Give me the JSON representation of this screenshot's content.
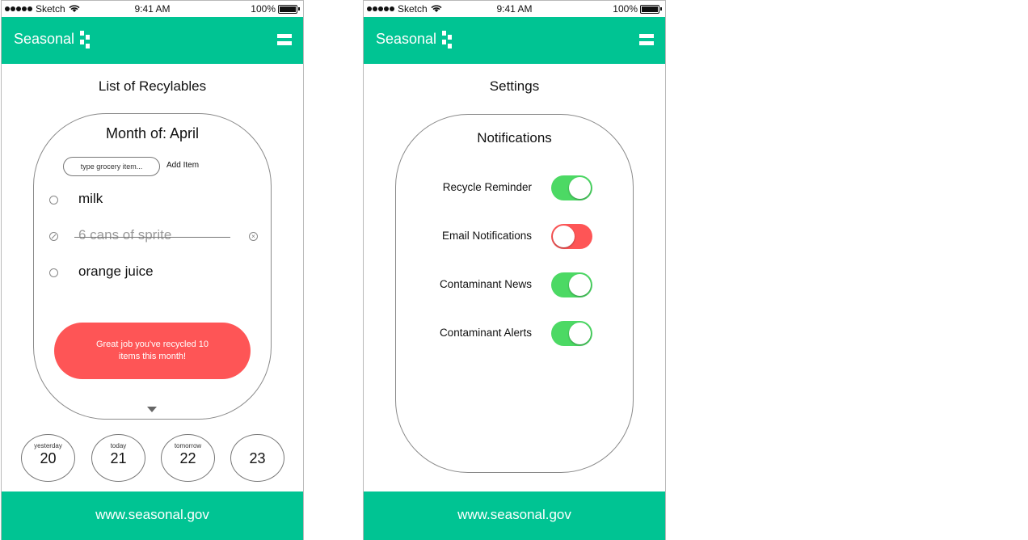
{
  "colors": {
    "brand": "#00c493",
    "accent_red": "#fe5556",
    "toggle_on": "#4cd964",
    "toggle_off": "#fe5556"
  },
  "status_bar": {
    "carrier": "Sketch",
    "time": "9:41 AM",
    "battery": "100%"
  },
  "app": {
    "brand": "Seasonal",
    "footer_url": "www.seasonal.gov"
  },
  "screen1": {
    "title": "List of Recylables",
    "month_label": "Month of: April",
    "input_placeholder": "type grocery item...",
    "add_item_label": "Add Item",
    "items": [
      {
        "text": "milk",
        "done": false
      },
      {
        "text": "6 cans of sprite",
        "done": true
      },
      {
        "text": "orange juice",
        "done": false
      }
    ],
    "cta": "Great job you've recycled 10 items this month!",
    "days": [
      {
        "label": "yesterday",
        "num": "20"
      },
      {
        "label": "today",
        "num": "21"
      },
      {
        "label": "tomorrow",
        "num": "22"
      },
      {
        "label": "",
        "num": "23"
      }
    ]
  },
  "screen2": {
    "title": "Settings",
    "section_title": "Notifications",
    "settings": [
      {
        "label": "Recycle Reminder",
        "on": true
      },
      {
        "label": "Email Notifications",
        "on": false
      },
      {
        "label": "Contaminant News",
        "on": true
      },
      {
        "label": "Contaminant Alerts",
        "on": true
      }
    ]
  }
}
